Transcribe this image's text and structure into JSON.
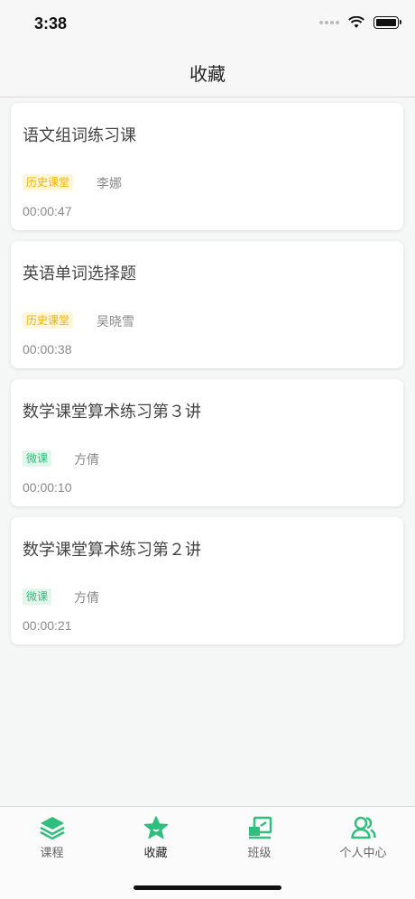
{
  "status": {
    "time": "3:38"
  },
  "nav": {
    "title": "收藏"
  },
  "favorites": [
    {
      "title": "语文组词练习课",
      "tag": "历史课堂",
      "tag_type": "history",
      "teacher": "李娜",
      "duration": "00:00:47"
    },
    {
      "title": "英语单词选择题",
      "tag": "历史课堂",
      "tag_type": "history",
      "teacher": "吴晓雪",
      "duration": "00:00:38"
    },
    {
      "title": "数学课堂算术练习第３讲",
      "tag": "微课",
      "tag_type": "micro",
      "teacher": "方倩",
      "duration": "00:00:10"
    },
    {
      "title": "数学课堂算术练习第２讲",
      "tag": "微课",
      "tag_type": "micro",
      "teacher": "方倩",
      "duration": "00:00:21"
    }
  ],
  "tabs": [
    {
      "label": "课程",
      "icon": "layers-icon",
      "active": false
    },
    {
      "label": "收藏",
      "icon": "star-icon",
      "active": true
    },
    {
      "label": "班级",
      "icon": "classroom-icon",
      "active": false
    },
    {
      "label": "个人中心",
      "icon": "users-icon",
      "active": false
    }
  ],
  "colors": {
    "accent": "#2fbf7c",
    "history_tag_bg": "#fff6d9",
    "history_tag_fg": "#f2b200",
    "micro_tag_bg": "#e3f6ec"
  }
}
